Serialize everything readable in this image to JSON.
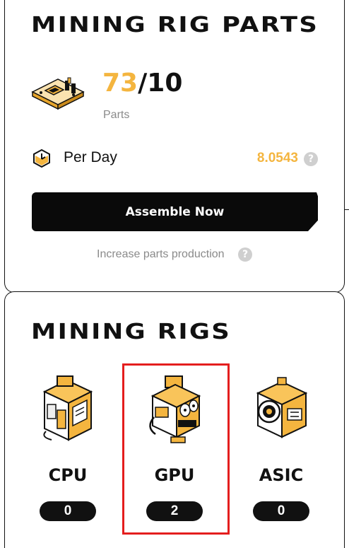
{
  "parts_panel": {
    "title": "MINING RIG PARTS",
    "current_parts": "73",
    "separator": "/",
    "max_parts": "10",
    "parts_label": "Parts",
    "per_day_label": "Per Day",
    "per_day_value": "8.0543",
    "help_glyph": "?",
    "assemble_button": "Assemble Now",
    "increase_link": "Increase parts production",
    "accent_color": "#f4b53f"
  },
  "rigs_panel": {
    "title": "MINING RIGS",
    "selected": "GPU",
    "selection_color": "#e41e1e",
    "rigs": [
      {
        "label": "CPU",
        "count": "0",
        "icon": "cpu-rig-icon"
      },
      {
        "label": "GPU",
        "count": "2",
        "icon": "gpu-rig-icon"
      },
      {
        "label": "ASIC",
        "count": "0",
        "icon": "asic-rig-icon"
      }
    ]
  }
}
